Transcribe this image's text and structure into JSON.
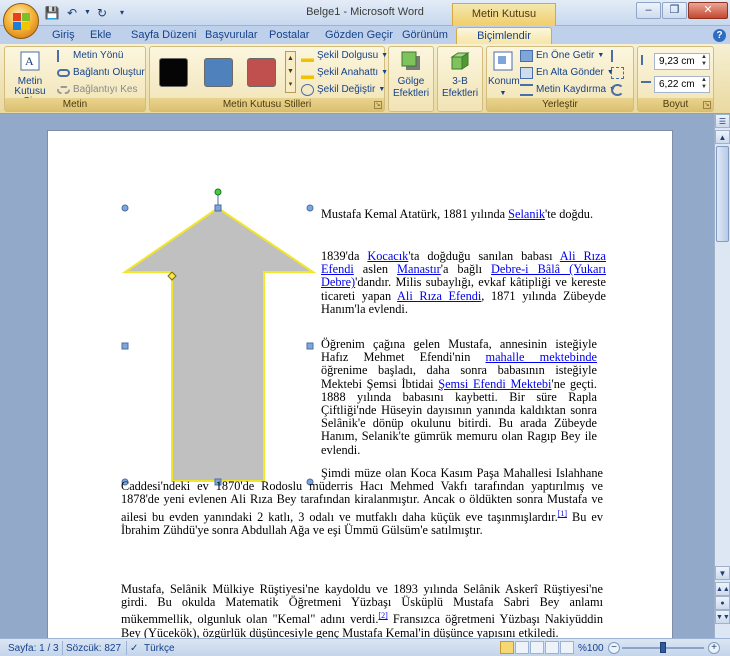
{
  "window": {
    "title": "Belge1 - Microsoft Word",
    "context_tab_group": "Metin Kutusu Araçları"
  },
  "tabs": [
    {
      "label": "Giriş"
    },
    {
      "label": "Ekle"
    },
    {
      "label": "Sayfa Düzeni"
    },
    {
      "label": "Başvurular"
    },
    {
      "label": "Postalar"
    },
    {
      "label": "Gözden Geçir"
    },
    {
      "label": "Görünüm"
    },
    {
      "label": "Biçimlendir"
    }
  ],
  "ribbon": {
    "metin": {
      "group_label": "Metin",
      "draw_textbox": "Metin Kutusu Çiz",
      "text_direction": "Metin Yönü",
      "create_link": "Bağlantı Oluştur",
      "break_link": "Bağlantıyı Kes"
    },
    "styles": {
      "group_label": "Metin Kutusu Stilleri",
      "swatch_colors": [
        "#050505",
        "#4f81bd",
        "#c0504d"
      ],
      "shape_fill": "Şekil Dolgusu",
      "shape_outline": "Şekil Anahattı",
      "change_shape": "Şekil Değiştir"
    },
    "shadow": {
      "label1": "Gölge",
      "label2": "Efektleri"
    },
    "threed": {
      "label1": "3-B",
      "label2": "Efektleri"
    },
    "arrange": {
      "group_label": "Yerleştir",
      "position": "Konum",
      "bring_front": "En Öne Getir",
      "send_back": "En Alta Gönder",
      "text_wrap": "Metin Kaydırma"
    },
    "size": {
      "group_label": "Boyut",
      "height": "9,23 cm",
      "width": "6,22 cm"
    }
  },
  "document": {
    "p1": {
      "t1": "Mustafa Kemal Atatürk, 1881 yılında ",
      "l1": "Selanik",
      "t2": "'te doğdu."
    },
    "p2": {
      "t1": "1839'da ",
      "l1": "Kocacık",
      "t2": "'ta doğduğu sanılan babası ",
      "l2": "Ali Rıza Efendi",
      "t3": " aslen ",
      "l3": "Manastır",
      "t4": "'a bağlı ",
      "l4": "Debre-i Bâlâ (Yukarı Debre)",
      "t5": "'dandır. Milis subaylığı, evkaf kâtipliği ve kereste ticareti yapan ",
      "l5": "Ali Rıza Efendi",
      "t6": ", 1871 yılında Zübeyde Hanım'la evlendi."
    },
    "p3": {
      "t1": "Öğrenim çağına gelen Mustafa, annesinin isteğiyle Hafız Mehmet Efendi'nin ",
      "l1": "mahalle mektebinde",
      "t2": " öğrenime başladı, daha sonra babasının isteğiyle Mektebi Şemsi İbtidai ",
      "l2": "Şemsi Efendi Mektebi",
      "t3": "'ne geçti. 1888 yılında babasını kaybetti. Bir süre Rapla Çiftliği'nde Hüseyin dayısının yanında kaldıktan sonra Selânik'e dönüp okulunu bitirdi. Bu arada Zübeyde Hanım, Selanik'te gümrük memuru olan Ragıp Bey ile evlendi."
    },
    "p4": {
      "t1": "Şimdi müze olan Koca Kasım Paşa Mahallesi Islahhane Caddesi'ndeki ev 1870'de Rodoslu müderris Hacı Mehmed Vakfı tarafından yaptırılmış ve 1878'de yeni evlenen Ali Rıza Bey tarafından kiralanmıştır.  Ancak o öldükten sonra Mustafa ve ailesi bu evden yanındaki 2 katlı, 3 odalı ve mutfaklı daha küçük eve taşınmışlardır.",
      "ref": "[1]",
      "t2": " Bu ev İbrahim Zühdü'ye sonra Abdullah Ağa ve eşi Ümmü Gülsüm'e satılmıştır."
    },
    "p5": {
      "t1": "Mustafa, Selânik Mülkiye Rüştiyesi'ne kaydoldu ve 1893 yılında Selânik Askerî Rüştiyesi'ne girdi. Bu okulda Matematik Öğretmeni Yüzbaşı Üsküplü Mustafa Sabri Bey anlamı mükemmellik, olgunluk olan \"Kemal\" adını verdi.",
      "ref": "[2]",
      "t2": " Fransızca öğretmeni Yüzbaşı Nakiyüddin Bey (Yücekök), özgürlük düşüncesiyle genç Mustafa Kemal'in düşünce yapısını etkiledi."
    }
  },
  "status": {
    "page": "Sayfa: 1 / 3",
    "words": "Sözcük: 827",
    "language": "Türkçe",
    "zoom": "%100"
  },
  "colors": {
    "arrow_fill": "#c0c0c0",
    "arrow_outline": "#f2e62a",
    "link": "#0000ee"
  }
}
